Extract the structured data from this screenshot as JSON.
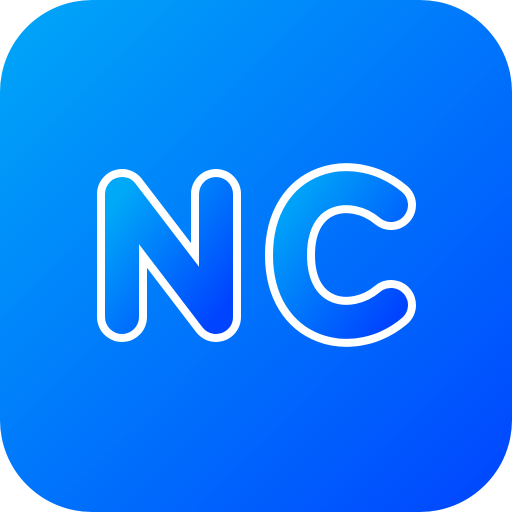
{
  "icon": {
    "name": "nc-app-icon",
    "letters": "NC",
    "gradient_start": "#00a8f8",
    "gradient_end": "#0044ff",
    "outline_color": "#ffffff"
  }
}
